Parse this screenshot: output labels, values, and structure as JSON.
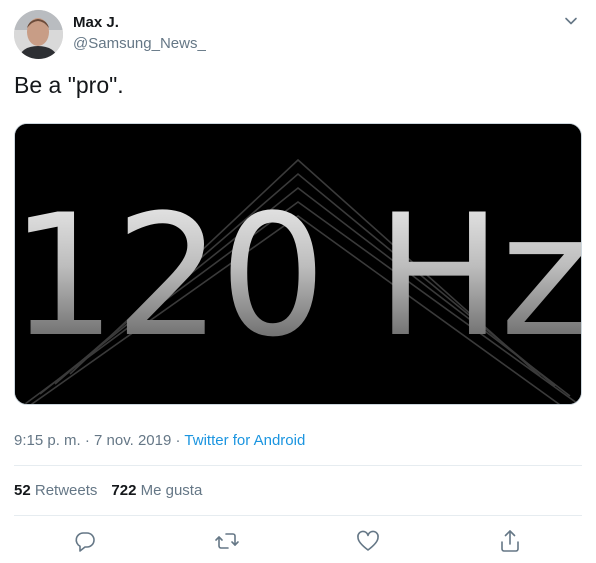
{
  "author": {
    "name": "Max J.",
    "handle": "@Samsung_News_",
    "avatar_icon": "avatar-photo"
  },
  "tweet": {
    "text": "Be a \"pro\"."
  },
  "media": {
    "headline": "120 Hz"
  },
  "meta": {
    "time": "9:15 p. m.",
    "sep1": "·",
    "date": "7 nov. 2019",
    "sep2": "·",
    "source": "Twitter for Android"
  },
  "stats": {
    "retweets_count": "52",
    "retweets_label": "Retweets",
    "likes_count": "722",
    "likes_label": "Me gusta"
  },
  "icons": {
    "more": "chevron-down-icon",
    "reply": "reply-icon",
    "retweet": "retweet-icon",
    "like": "heart-icon",
    "share": "share-icon"
  },
  "colors": {
    "accent": "#1b95e0",
    "muted": "#657786",
    "text": "#14171a"
  }
}
